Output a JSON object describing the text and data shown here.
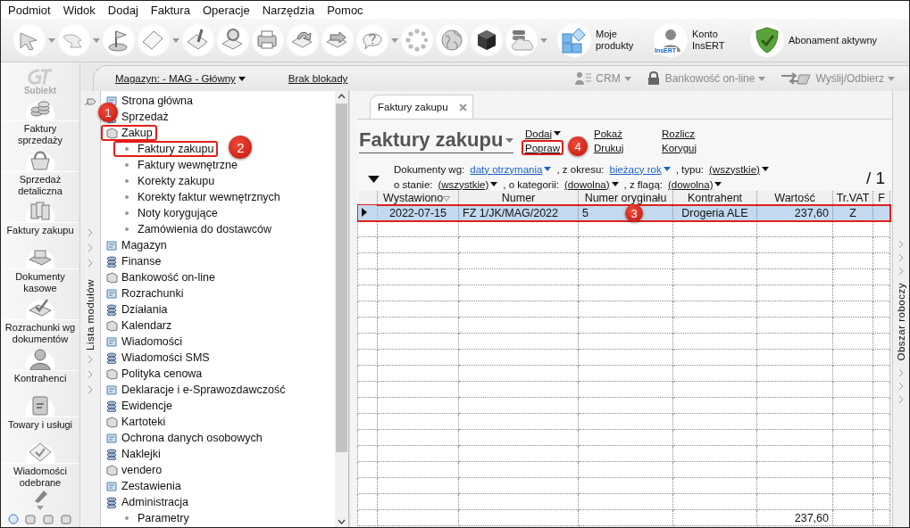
{
  "menu": [
    "Podmiot",
    "Widok",
    "Dodaj",
    "Faktura",
    "Operacje",
    "Narzędzia",
    "Pomoc"
  ],
  "toolbar": {
    "buttons": [
      {
        "dropdown": true
      },
      {
        "dropdown": true
      },
      {
        "dropdown": false
      },
      {
        "dropdown": true
      },
      {
        "dropdown": false
      },
      {
        "dropdown": false
      },
      {
        "dropdown": false
      },
      {
        "dropdown": false
      },
      {
        "dropdown": false
      },
      {
        "dropdown": true
      },
      {
        "dropdown": false
      },
      {
        "dropdown": false
      },
      {
        "dropdown": false
      },
      {
        "dropdown": true
      }
    ],
    "shortcuts": [
      {
        "kind": "products",
        "label": "Moje produkty"
      },
      {
        "kind": "account",
        "label": "Konto InsERT",
        "icon_text": "InsERT"
      },
      {
        "kind": "subscription",
        "label": "Abonament aktywny"
      }
    ]
  },
  "rail": {
    "logo": "Subiekt",
    "items": [
      "Faktury sprzedaży",
      "Sprzedaż detaliczna",
      "Faktury zakupu",
      "Dokumenty kasowe",
      "Rozrachunki wg dokumentów",
      "Kontrahenci",
      "Towary i usługi",
      "Wiadomości odebrane"
    ]
  },
  "topbar": {
    "warehouse": "Magazyn: - MAG - Główny",
    "lock": "Brak blokady",
    "actions": [
      {
        "label": "CRM",
        "disabled": true
      },
      {
        "label": "Bankowość on-line",
        "disabled": true
      },
      {
        "label": "Wyślij/Odbierz",
        "disabled": true
      }
    ]
  },
  "modules": {
    "title": "Lista modułów",
    "items": [
      {
        "label": "Strona główna"
      },
      {
        "label": "Sprzedaż"
      },
      {
        "label": "Zakup",
        "expanded": true,
        "marked": true,
        "callout": "1",
        "children": [
          {
            "label": "Faktury zakupu",
            "marked": true,
            "callout": "2"
          },
          {
            "label": "Faktury wewnętrzne",
            "marked": false
          },
          {
            "label": "Korekty zakupu",
            "marked": false
          },
          {
            "label": "Korekty faktur wewnętrznych",
            "marked": false
          },
          {
            "label": "Noty korygujące",
            "marked": false
          },
          {
            "label": "Zamówienia do dostawców",
            "marked": false
          }
        ]
      },
      {
        "label": "Magazyn"
      },
      {
        "label": "Finanse"
      },
      {
        "label": "Bankowość on-line"
      },
      {
        "label": "Rozrachunki"
      },
      {
        "label": "Działania"
      },
      {
        "label": "Kalendarz"
      },
      {
        "label": "Wiadomości"
      },
      {
        "label": "Wiadomości SMS"
      },
      {
        "label": "Polityka cenowa"
      },
      {
        "label": "Deklaracje i e-Sprawozdawczość"
      },
      {
        "label": "Ewidencje"
      },
      {
        "label": "Kartoteki"
      },
      {
        "label": "Ochrona danych osobowych"
      },
      {
        "label": "Naklejki"
      },
      {
        "label": "vendero"
      },
      {
        "label": "Zestawienia"
      },
      {
        "label": "Administracja",
        "expanded": true,
        "children": [
          {
            "label": "Parametry",
            "marked": false
          }
        ]
      }
    ]
  },
  "main": {
    "tab": {
      "label": "Faktury zakupu",
      "closable": true
    },
    "title": "Faktury zakupu",
    "actions": [
      {
        "label": "Dodaj",
        "dropdown": true,
        "marked": false
      },
      {
        "label": "Popraw",
        "dropdown": false,
        "marked": true,
        "callout": "4"
      },
      {
        "label": "Pokaż",
        "dropdown": false,
        "marked": false
      },
      {
        "label": "Drukuj",
        "dropdown": false,
        "marked": false
      },
      {
        "label": "Rozlicz",
        "dropdown": false,
        "marked": false
      },
      {
        "label": "Koryguj",
        "dropdown": false,
        "marked": false
      }
    ],
    "filters": [
      [
        {
          "label": "Dokumenty wg:",
          "value": "daty otrzymania",
          "active": true
        },
        {
          "label": ", z okresu:",
          "value": "bieżący rok",
          "active": true
        },
        {
          "label": ", typu:",
          "value": "(wszystkie)",
          "active": false
        }
      ],
      [
        {
          "label": "o stanie:",
          "value": "(wszystkie)",
          "active": false
        },
        {
          "label": ", o kategorii:",
          "value": "(dowolna)",
          "active": false
        },
        {
          "label": ", z flagą:",
          "value": "(dowolna)",
          "active": false
        }
      ]
    ],
    "page_count": "/ 1",
    "table": {
      "columns": [
        {
          "label": "Wystawiono",
          "sorted": true
        },
        {
          "label": "Numer",
          "sorted": false
        },
        {
          "label": "Numer oryginału",
          "sorted": false
        },
        {
          "label": "Kontrahent",
          "sorted": false
        },
        {
          "label": "Wartość",
          "sorted": false
        },
        {
          "label": "Tr.VAT",
          "sorted": false
        },
        {
          "label": "F",
          "sorted": false
        }
      ],
      "rows": [
        {
          "selected": true,
          "marked": true,
          "callout": "3",
          "cells": [
            "2022-07-15",
            "FZ 1/JK/MAG/2022",
            "5",
            "Drogeria ALE",
            "237,60",
            "Z",
            ""
          ]
        }
      ],
      "totals": {
        "Wartość": "237,60"
      }
    }
  },
  "workspace": {
    "title": "Obszar roboczy"
  }
}
